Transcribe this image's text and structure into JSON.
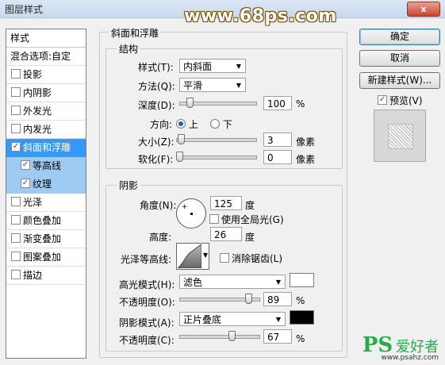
{
  "window": {
    "title": "图层样式",
    "close_label": "x",
    "watermark": "www.68ps.com"
  },
  "style_list": {
    "header": "样式",
    "blend_options": "混合选项:自定",
    "items": [
      {
        "label": "投影",
        "checked": false
      },
      {
        "label": "内阴影",
        "checked": false
      },
      {
        "label": "外发光",
        "checked": false
      },
      {
        "label": "内发光",
        "checked": false
      },
      {
        "label": "斜面和浮雕",
        "checked": true
      },
      {
        "label": "等高线",
        "checked": true
      },
      {
        "label": "纹理",
        "checked": true
      },
      {
        "label": "光泽",
        "checked": false
      },
      {
        "label": "颜色叠加",
        "checked": false
      },
      {
        "label": "渐变叠加",
        "checked": false
      },
      {
        "label": "图案叠加",
        "checked": false
      },
      {
        "label": "描边",
        "checked": false
      }
    ]
  },
  "bevel": {
    "title": "斜面和浮雕",
    "structure": {
      "title": "结构",
      "style_label": "样式(T):",
      "style_value": "内斜面",
      "technique_label": "方法(Q):",
      "technique_value": "平滑",
      "depth_label": "深度(D):",
      "depth_value": "100",
      "depth_unit": "%",
      "depth_fraction": 0.1,
      "direction_label": "方向:",
      "direction_up": "上",
      "direction_down": "下",
      "size_label": "大小(Z):",
      "size_value": "3",
      "size_unit": "像素",
      "size_fraction": 0.02,
      "soften_label": "软化(F):",
      "soften_value": "0",
      "soften_unit": "像素",
      "soften_fraction": 0.0
    },
    "shading": {
      "title": "阴影",
      "angle_label": "角度(N):",
      "angle_value": "125",
      "angle_unit": "度",
      "global_light_label": "使用全局光(G)",
      "altitude_label": "高度:",
      "altitude_value": "26",
      "altitude_unit": "度",
      "gloss_contour_label": "光泽等高线:",
      "anti_alias_label": "消除锯齿(L)",
      "highlight_mode_label": "高光模式(H):",
      "highlight_mode_value": "滤色",
      "highlight_color": "#ffffff",
      "highlight_opacity_label": "不透明度(O):",
      "highlight_opacity_value": "89",
      "highlight_opacity_unit": "%",
      "highlight_opacity_fraction": 0.89,
      "shadow_mode_label": "阴影模式(A):",
      "shadow_mode_value": "正片叠底",
      "shadow_color": "#000000",
      "shadow_opacity_label": "不透明度(C):",
      "shadow_opacity_value": "67",
      "shadow_opacity_unit": "%",
      "shadow_opacity_fraction": 0.67
    }
  },
  "actions": {
    "ok": "确定",
    "cancel": "取消",
    "new_style": "新建样式(W)...",
    "preview_label": "预览(V)",
    "preview_checked": true
  },
  "logo": {
    "text": "PS",
    "sub": "爱好者",
    "url": "www.psahz.com"
  }
}
